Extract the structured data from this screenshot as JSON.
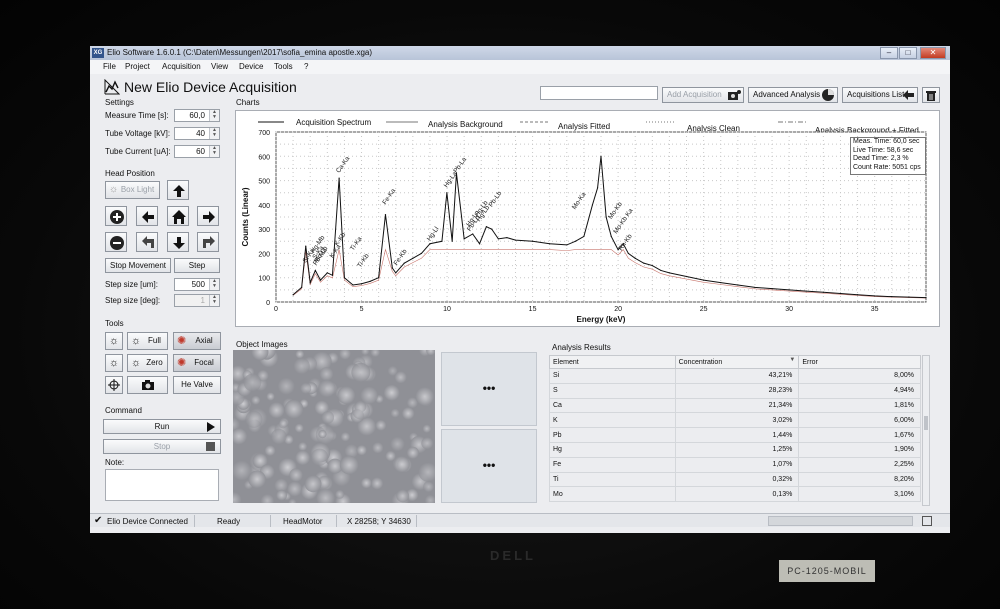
{
  "window": {
    "app_icon_text": "XG",
    "title": "Elio Software 1.6.0.1 (C:\\Daten\\Messungen\\2017\\sofia_emina apostle.xga)",
    "btn_min": "–",
    "btn_max": "□",
    "btn_close": "✕"
  },
  "menu": [
    "File",
    "Project",
    "Acquisition",
    "View",
    "Device",
    "Tools",
    "?"
  ],
  "header": {
    "page_title": "New Elio Device Acquisition",
    "search_value": "",
    "add_acquisition": "Add Acquisition",
    "advanced_analysis": "Advanced Analysis",
    "acquisitions_list": "Acquisitions List"
  },
  "settings": {
    "section": "Settings",
    "measure_time_label": "Measure Time [s]:",
    "measure_time_value": "60,0",
    "tube_voltage_label": "Tube Voltage [kV]:",
    "tube_voltage_value": "40",
    "tube_current_label": "Tube Current [uA]:",
    "tube_current_value": "60"
  },
  "head_position": {
    "section": "Head Position",
    "box_light": "Box Light",
    "stop_movement": "Stop Movement",
    "step": "Step",
    "step_size_um_label": "Step size [um]:",
    "step_size_um_value": "500",
    "step_size_deg_label": "Step size [deg]:",
    "step_size_deg_value": "1"
  },
  "tools": {
    "section": "Tools",
    "full": "Full",
    "axial": "Axial",
    "zero": "Zero",
    "focal": "Focal",
    "he_valve": "He Valve"
  },
  "command": {
    "section": "Command",
    "run": "Run",
    "stop": "Stop",
    "note_label": "Note:",
    "note_value": ""
  },
  "charts": {
    "section": "Charts",
    "legend": [
      "Acquisition Spectrum",
      "Analysis Background",
      "Analysis Fitted",
      "Analysis Clean",
      "Analysis Background + Fitted"
    ],
    "info": {
      "meas_time": "Meas. Time: 60,0 sec",
      "live_time": "Live Time: 58,6 sec",
      "dead_time": "Dead Time: 2,3 %",
      "count_rate": "Count Rate: 5051 cps"
    }
  },
  "chart_data": {
    "type": "line",
    "xlabel": "Energy (keV)",
    "ylabel": "Counts (Linear)",
    "xlim": [
      0,
      38
    ],
    "ylim": [
      0,
      700
    ],
    "x_ticks": [
      0,
      5,
      10,
      15,
      20,
      25,
      30,
      35
    ],
    "y_ticks": [
      0,
      100,
      200,
      300,
      400,
      500,
      600,
      700
    ],
    "grid": true,
    "legend_position": "top",
    "series": [
      {
        "name": "Acquisition Spectrum",
        "color": "#111111",
        "x": [
          1.0,
          1.5,
          1.74,
          2.0,
          2.3,
          2.6,
          3.0,
          3.3,
          3.69,
          4.0,
          4.5,
          5.0,
          5.5,
          6.0,
          6.4,
          6.8,
          7.0,
          7.5,
          8.0,
          8.5,
          9.0,
          9.7,
          9.99,
          10.3,
          10.55,
          11.0,
          11.5,
          11.9,
          12.3,
          12.61,
          13.0,
          13.5,
          14.0,
          15.0,
          16.0,
          17.0,
          17.5,
          18.0,
          18.5,
          18.8,
          19.0,
          19.3,
          19.6,
          20.0,
          20.3,
          20.6,
          21.0,
          21.5,
          22.0,
          22.5,
          23.0,
          24.0,
          25.0,
          26.0,
          27.0,
          28.0,
          29.0,
          30.0,
          31.0,
          32.0,
          33.0,
          34.0,
          35.0,
          36.0,
          37.0,
          38.0
        ],
        "y": [
          30,
          60,
          230,
          80,
          130,
          90,
          120,
          110,
          510,
          100,
          70,
          75,
          85,
          100,
          360,
          140,
          120,
          160,
          180,
          200,
          240,
          250,
          450,
          250,
          530,
          260,
          280,
          240,
          310,
          300,
          260,
          265,
          255,
          250,
          240,
          235,
          250,
          270,
          400,
          470,
          600,
          350,
          270,
          215,
          240,
          200,
          180,
          160,
          150,
          130,
          120,
          105,
          90,
          80,
          70,
          60,
          55,
          50,
          45,
          40,
          35,
          30,
          25,
          22,
          20,
          18
        ]
      }
    ],
    "annotations": [
      "Si-Ka",
      "Hg-Mb",
      "S-Ka",
      "Mo-Lb",
      "Pb-Ma",
      "K-Ka",
      "K-Kb",
      "Ca-Ka",
      "Ti-Ka",
      "Ti-Kb",
      "Fe-Ka",
      "Fe-Kb",
      "Hg-Ll",
      "Hg-La",
      "Pb-La",
      "Hg-Ln",
      "Pb-Ln",
      "Hg-Lb",
      "Hg-Lb",
      "Pb-Lb",
      "Mo-Ka",
      "Mo-Kb",
      "Mo-Kb Ka",
      "Rh-Kb"
    ]
  },
  "object_images": {
    "section": "Object Images",
    "more": "•••"
  },
  "analysis": {
    "section": "Analysis Results",
    "columns": [
      "Element",
      "Concentration",
      "Error"
    ],
    "rows": [
      [
        "Si",
        "43,21%",
        "8,00%"
      ],
      [
        "S",
        "28,23%",
        "4,94%"
      ],
      [
        "Ca",
        "21,34%",
        "1,81%"
      ],
      [
        "K",
        "3,02%",
        "6,00%"
      ],
      [
        "Pb",
        "1,44%",
        "1,67%"
      ],
      [
        "Hg",
        "1,25%",
        "1,90%"
      ],
      [
        "Fe",
        "1,07%",
        "2,25%"
      ],
      [
        "Ti",
        "0,32%",
        "8,20%"
      ],
      [
        "Mo",
        "0,13%",
        "3,10%"
      ]
    ]
  },
  "status": {
    "connected": "Elio Device Connected",
    "state": "Ready",
    "motor": "HeadMotor",
    "coords": "X 28258; Y 34630"
  },
  "hardware": {
    "brand": "DELL",
    "tag": "PC-1205-MOBIL"
  },
  "colors": {
    "accent": "#33558c",
    "spectrum": "#111111",
    "laser_red": "#c0392b"
  }
}
